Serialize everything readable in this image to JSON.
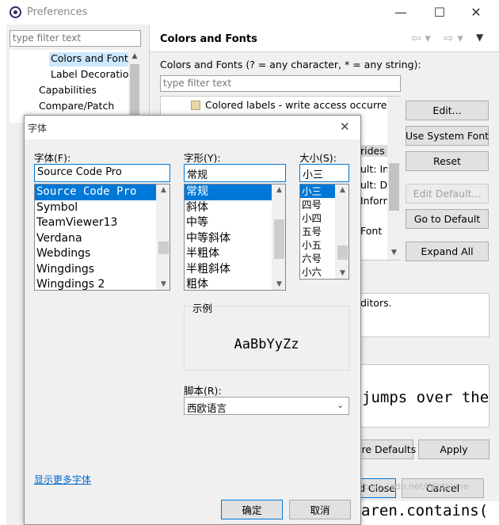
{
  "window": {
    "title": "Preferences",
    "min": "—",
    "max": "☐",
    "close": "✕"
  },
  "sidebar": {
    "filter_placeholder": "type filter text",
    "items": [
      "Colors and Fonts",
      "Label Decorations",
      "Capabilities",
      "Compare/Patch"
    ]
  },
  "page": {
    "title": "Colors and Fonts",
    "desc": "Colors and Fonts (? = any character, * = any string):",
    "filter_placeholder": "type filter text",
    "tree_item": "Colored labels - write access occurrences",
    "tree_frag": [
      "rides",
      "ult: Inte",
      "ult: Dia",
      "Inform",
      "Font"
    ],
    "desc_frag": "ditors.",
    "preview_frag": "jumps over the",
    "bottom_frag": "aren.contains("
  },
  "buttons": {
    "edit": "Edit...",
    "use_system_font": "Use System Font",
    "reset": "Reset",
    "edit_default": "Edit Default...",
    "go_to_default": "Go to Default",
    "expand_all": "Expand All",
    "restore_defaults": "ore Defaults",
    "apply": "Apply",
    "apply_close": "d Close",
    "cancel": "Cancel"
  },
  "font_dialog": {
    "title": "字体",
    "close": "✕",
    "font_label": "字体(F):",
    "font_value": "Source Code Pro",
    "fonts": [
      "Source Code Pro",
      "Symbol",
      "TeamViewer13",
      "Verdana",
      "Webdings",
      "Wingdings",
      "Wingdings 2"
    ],
    "style_label": "字形(Y):",
    "style_value": "常规",
    "styles": [
      "常规",
      "斜体",
      "中等",
      "中等斜体",
      "半粗体",
      "半粗斜体",
      "粗体"
    ],
    "size_label": "大小(S):",
    "size_value": "小三",
    "sizes": [
      "小三",
      "四号",
      "小四",
      "五号",
      "小五",
      "六号",
      "小六"
    ],
    "sample_label": "示例",
    "sample_text": "AaBbYyZz",
    "script_label": "脚本(R):",
    "script_value": "西欧语言",
    "more_fonts": "显示更多字体",
    "ok": "确定",
    "cancel": "取消"
  },
  "watermark": "https://blog.csdn.net/Wildalone"
}
